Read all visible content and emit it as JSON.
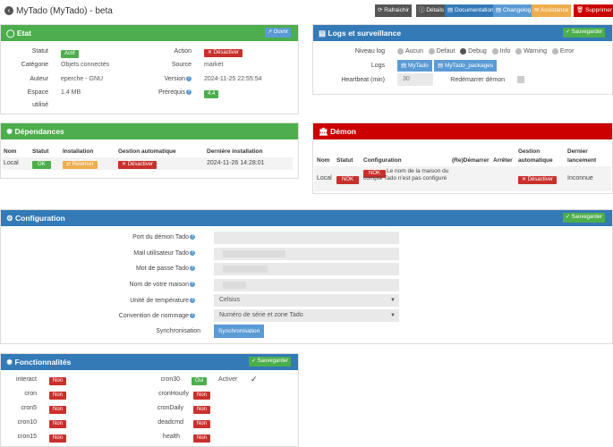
{
  "window": {
    "title": "MyTado (MyTado) - beta"
  },
  "toolbar": {
    "refresh": "Rafraichir",
    "details": "Détails",
    "docs": "Documentation",
    "changelog": "Changelog",
    "assistance": "Assistance",
    "delete": "Supprimer"
  },
  "etat": {
    "title": "Etat",
    "open_btn": "Ouvrir",
    "statut_label": "Statut",
    "statut_value": "Actif",
    "categorie_label": "Catégorie",
    "categorie_value": "Objets connectés",
    "auteur_label": "Auteur",
    "auteur_value": "eperche - GNU",
    "espace_label": "Espace",
    "espace_label2": "utilisé",
    "espace_value": "1.4 MB",
    "action_label": "Action",
    "action_value": "Désactiver",
    "source_label": "Source",
    "source_value": "market",
    "version_label": "Version",
    "version_value": "2024-11-25 22:55:54",
    "prerequis_label": "Prérequis",
    "prerequis_value": "4.4"
  },
  "logs": {
    "title": "Logs et surveillance",
    "save_btn": "Sauvegarder",
    "niveau_label": "Niveau log",
    "levels": [
      "Aucun",
      "Defaut",
      "Debug",
      "Info",
      "Warning",
      "Error"
    ],
    "logs_label": "Logs",
    "log_btn1": "MyTado",
    "log_btn2": "MyTado_packages",
    "heartbeat_label": "Heartbeat (min)",
    "heartbeat_value": "30",
    "restart_label": "Redémarrer démon"
  },
  "deps": {
    "title": "Dépendances",
    "headers": [
      "Nom",
      "Statut",
      "Installation",
      "Gestion automatique",
      "Dernière installation"
    ],
    "row": {
      "nom": "Local",
      "statut": "OK",
      "installation": "Relancer",
      "gestion": "Désactiver",
      "derniere": "2024-11-26 14:28:01"
    }
  },
  "demon": {
    "title": "Démon",
    "headers": [
      "Nom",
      "Statut",
      "Configuration",
      "(Re)Démarrer",
      "Arrêter",
      "Gestion",
      "automatique",
      "Dernier",
      "lancement"
    ],
    "row": {
      "nom": "Local",
      "statut": "NOK",
      "config_badge": "NOK",
      "config_text": "Le nom de la maison du compte Tado n'est pas configuré",
      "gestion": "Désactiver",
      "dernier": "Inconnue"
    }
  },
  "config": {
    "title": "Configuration",
    "save_btn": "Sauvegarder",
    "port_label": "Port du démon Tado",
    "mail_label": "Mail utilisateur Tado",
    "pass_label": "Mot de passe Tado",
    "maison_label": "Nom de votre maison",
    "unite_label": "Unité de température",
    "unite_value": "Celsius",
    "convention_label": "Convention de nommage",
    "convention_value": "Numéro de série et zone Tado",
    "sync_label": "Synchronisation",
    "sync_btn": "Synchronisation"
  },
  "fonc": {
    "title": "Fonctionnalités",
    "save_btn": "Sauvegarder",
    "left": [
      {
        "name": "interact",
        "value": "Non"
      },
      {
        "name": "cron",
        "value": "Non"
      },
      {
        "name": "cron5",
        "value": "Non"
      },
      {
        "name": "cron10",
        "value": "Non"
      },
      {
        "name": "cron15",
        "value": "Non"
      }
    ],
    "right": [
      {
        "name": "cron30",
        "value": "Oui"
      },
      {
        "name": "cronHourly",
        "value": "Non"
      },
      {
        "name": "cronDaily",
        "value": "Non"
      },
      {
        "name": "deadcmd",
        "value": "Non"
      },
      {
        "name": "health",
        "value": "Non"
      }
    ],
    "activer_label": "Activer"
  }
}
